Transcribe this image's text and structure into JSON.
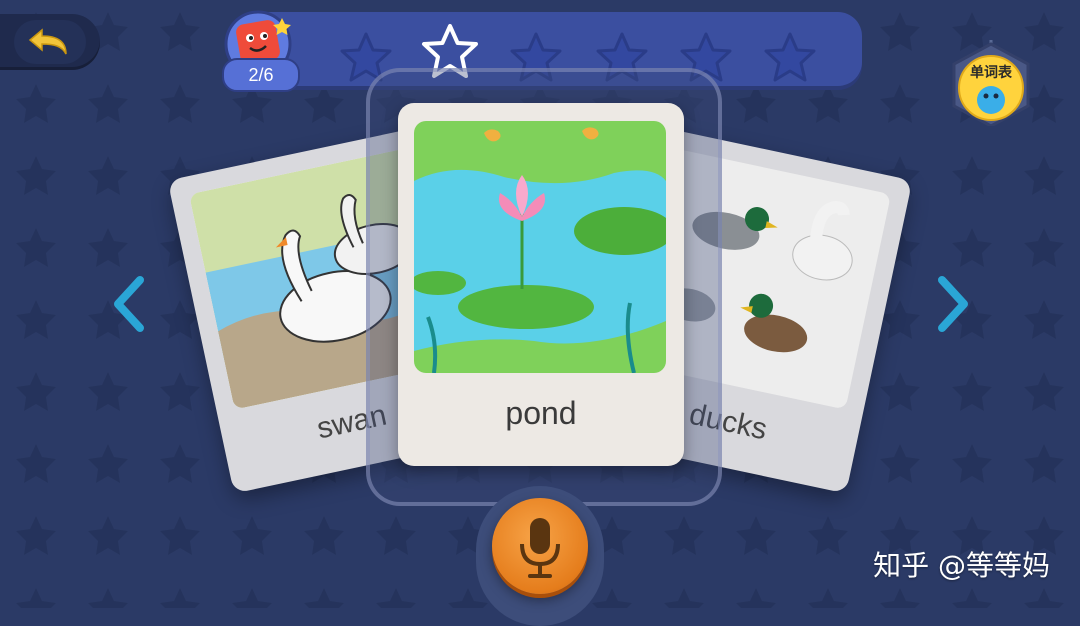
{
  "progress": {
    "count": "2/6",
    "stars_total": 6,
    "active_star_index": 0
  },
  "wordlist": {
    "label": "单词表"
  },
  "cards": {
    "left": {
      "word": "swan"
    },
    "center": {
      "word": "pond"
    },
    "right": {
      "word": "ducks"
    }
  },
  "watermark": "知乎 @等等妈",
  "colors": {
    "background": "#2b3a66",
    "progress_bar": "#3b4fa0",
    "accent_orange": "#e57d1c",
    "arrow_blue": "#2aa6d6"
  },
  "icons": {
    "back": "undo-arrow-icon",
    "mic": "microphone-icon",
    "prev": "chevron-left-icon",
    "next": "chevron-right-icon"
  }
}
